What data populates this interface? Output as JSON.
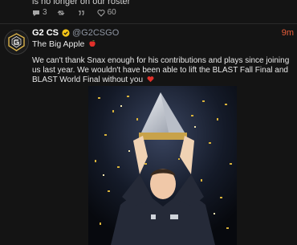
{
  "previous_post": {
    "text": "is no longer on our roster",
    "replies": "3",
    "likes": "60"
  },
  "post": {
    "author": "G2 CS",
    "handle": "@G2CSGO",
    "time": "9m",
    "line1": "The Big Apple",
    "body": "We can't thank Snax enough for his contributions and plays since joining us last year. We wouldn't have been able to lift the BLAST Fall Final and BLAST World Final without you"
  },
  "icons": {
    "reply": "reply-icon",
    "retweet": "retweet-icon",
    "quote": "quote-icon",
    "like": "heart-outline-icon",
    "verified": "verified-badge-icon",
    "apple": "red-apple-emoji",
    "heart": "red-heart-emoji"
  },
  "colors": {
    "background": "#141414",
    "timestamp": "#e85d3a",
    "verified": "#f5c518",
    "handle": "#8f96a3"
  }
}
